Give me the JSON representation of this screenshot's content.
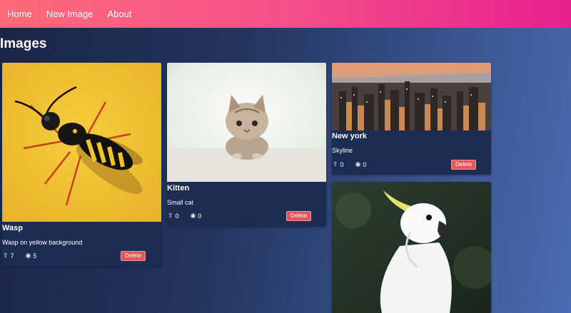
{
  "nav": {
    "home": "Home",
    "new_image": "New Image",
    "about": "About"
  },
  "page": {
    "title": "Images"
  },
  "cards": [
    {
      "title": "Wasp",
      "description": "Wasp on yellow background",
      "upvotes": "7",
      "views": "5",
      "delete_label": "Delete"
    },
    {
      "title": "Kitten",
      "description": "Small cat",
      "upvotes": "0",
      "views": "0",
      "delete_label": "Delete"
    },
    {
      "title": "New york",
      "description": "Skyline",
      "upvotes": "0",
      "views": "0",
      "delete_label": "Delete"
    }
  ],
  "icons": {
    "upvote": "arrow-up-icon",
    "views": "eye-icon"
  },
  "colors": {
    "navbar_start": "#fd6a78",
    "navbar_end": "#e8208e",
    "delete_button": "#e5565a",
    "card_bg": "#1c2c52"
  }
}
